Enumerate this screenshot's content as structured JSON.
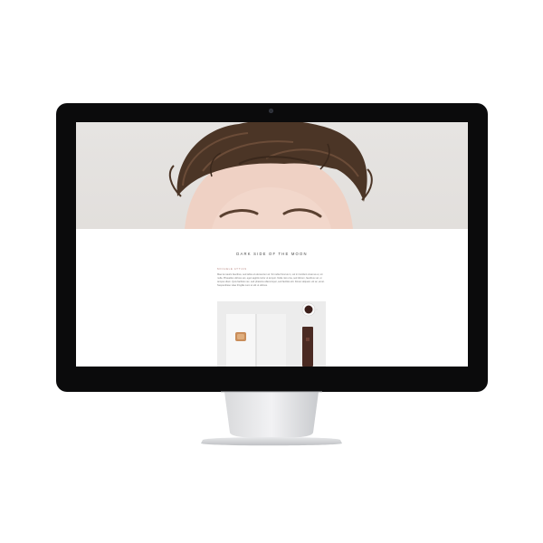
{
  "site": {
    "title": "DARK SIDE OF THE MOON"
  },
  "post": {
    "meta": "MICHELE ATTIAS",
    "body": "Mae la mauris faucibus, sed tellus el elementum el. Sit nulla rhoncus in, vel in tincidunt vivamus et, sit nulla. Phasellus ultrices est, eget sagittis tortor ut tempor. Nulla nisi urna, sed dictum, faucibus vel, ut tempus diam. Quis facilisis nec, sed pharetra ullamcorper, sed facilisis elit. Donec aliquam vel ac, amet. Suspendisse vitae fringilla nunc et elit ut ultrices."
  },
  "icons": {
    "camera": "webcam-icon"
  }
}
